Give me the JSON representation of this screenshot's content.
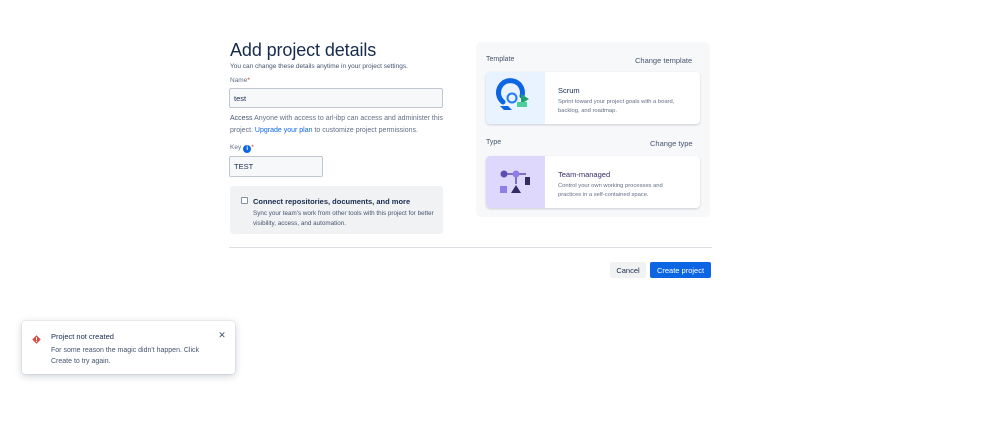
{
  "form": {
    "title": "Add project details",
    "subtitle": "You can change these details anytime in your project settings.",
    "name_label": "Name",
    "name_value": "test",
    "access_label": "Access",
    "access_text": "Anyone with access to arl-ibp can access and administer this project.",
    "upgrade_link": "Upgrade your plan",
    "access_suffix": "to customize project permissions.",
    "key_label": "Key",
    "key_value": "TEST",
    "connect_title": "Connect repositories, documents, and more",
    "connect_desc": "Sync your team's work from other tools with this project for better visibility, access, and automation."
  },
  "template": {
    "section_label": "Template",
    "change_label": "Change template",
    "card_title": "Scrum",
    "card_desc": "Sprint toward your project goals with a board, backlog, and roadmap."
  },
  "type": {
    "section_label": "Type",
    "change_label": "Change type",
    "card_title": "Team-managed",
    "card_desc": "Control your own working processes and practices in a self-contained space."
  },
  "actions": {
    "cancel_label": "Cancel",
    "create_label": "Create project"
  },
  "flag": {
    "title": "Project not created",
    "message": "For some reason the magic didn't happen. Click Create to try again."
  },
  "colors": {
    "primary": "#0c66e4",
    "error": "#e2483d",
    "type_card_bg": "#dfd8fd"
  }
}
